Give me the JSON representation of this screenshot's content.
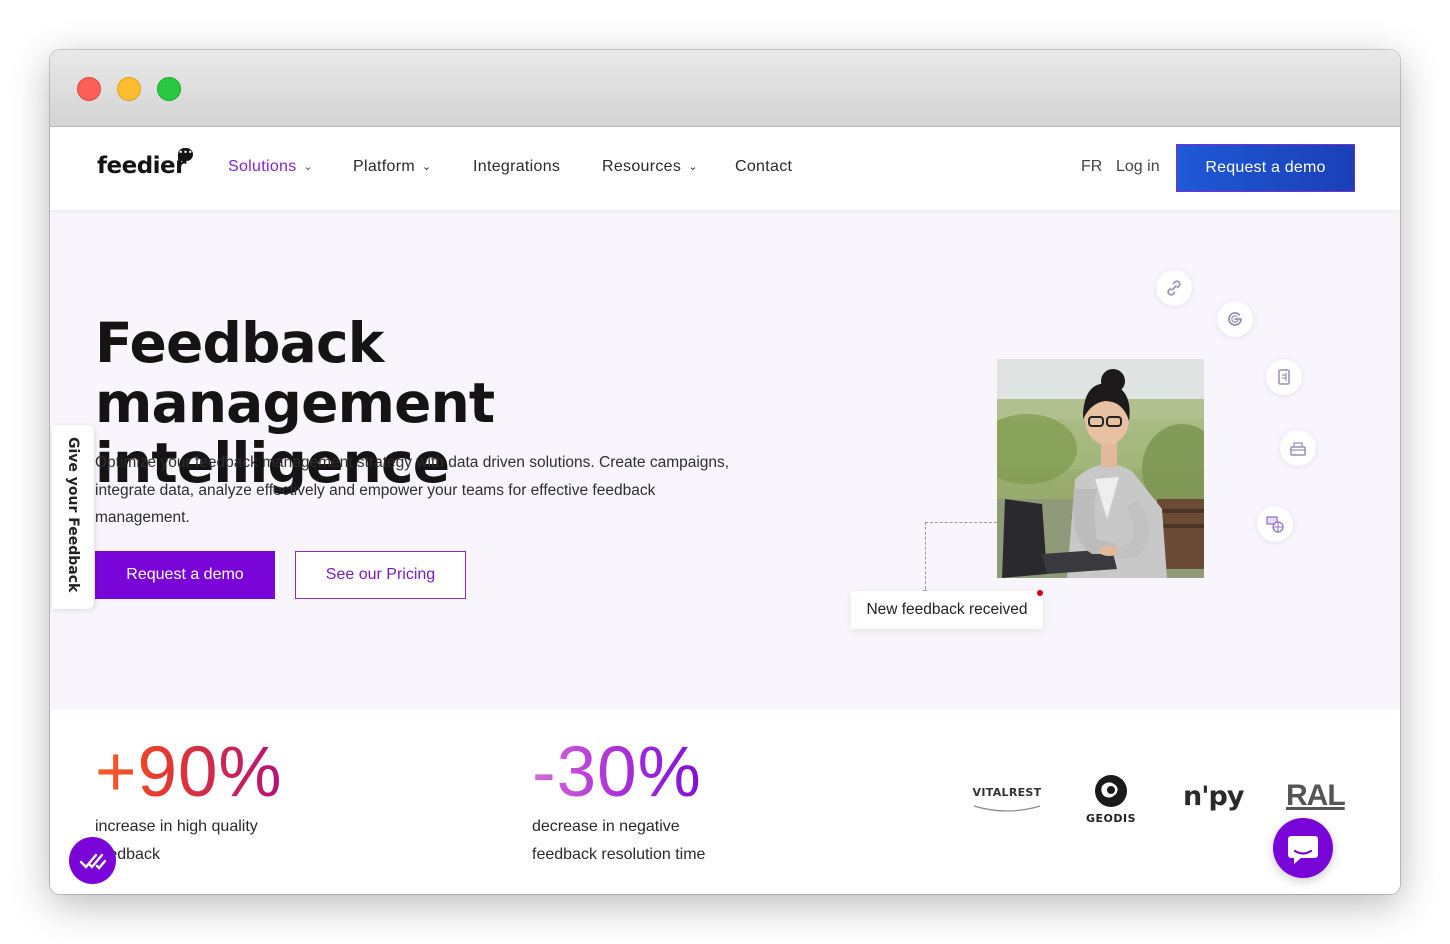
{
  "nav": {
    "logo": "feedier",
    "items": [
      {
        "label": "Solutions",
        "has_dropdown": true,
        "active": true
      },
      {
        "label": "Platform",
        "has_dropdown": true
      },
      {
        "label": "Integrations",
        "has_dropdown": false
      },
      {
        "label": "Resources",
        "has_dropdown": true
      },
      {
        "label": "Contact",
        "has_dropdown": false
      }
    ],
    "language": "FR",
    "login": "Log in",
    "cta": "Request a demo"
  },
  "hero": {
    "title_line1": "Feedback management",
    "title_line2": "intelligence",
    "subtitle": "Optimize your feedback management strategy with data driven solutions. Create campaigns, integrate data, analyze effectively and empower your teams for effective feedback management.",
    "primary_button": "Request a demo",
    "secondary_button": "See our Pricing",
    "side_tab": "Give your Feedback",
    "toast": "New feedback received",
    "floating_icons": [
      "link-icon",
      "google-icon",
      "document-icon",
      "mailbox-icon",
      "web-form-icon"
    ]
  },
  "stats": [
    {
      "value": "+90%",
      "label": "increase in high quality feedback"
    },
    {
      "value": "-30%",
      "label": "decrease in negative feedback resolution time"
    }
  ],
  "brands": [
    "VITALREST",
    "GEODIS",
    "n'py",
    "RAL"
  ],
  "colors": {
    "accent": "#7a05d8",
    "nav_cta": "#1f59d6",
    "hero_bg": "#f9f5fc",
    "text": "#141414"
  }
}
